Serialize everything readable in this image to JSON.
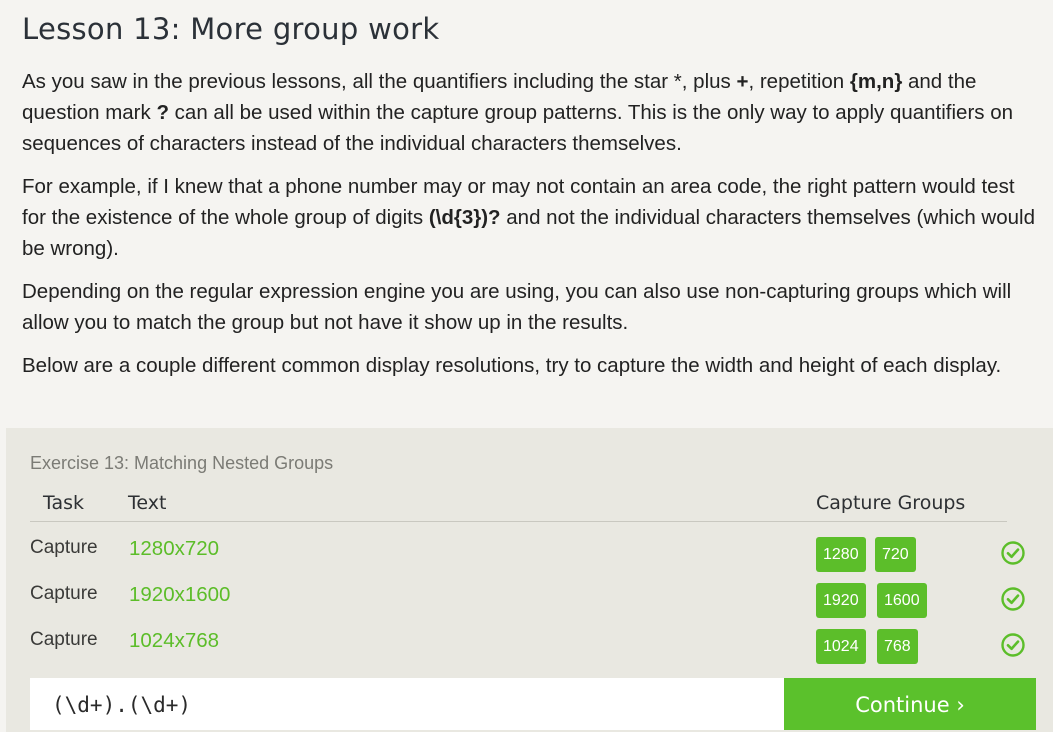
{
  "lesson": {
    "title": "Lesson 13: More group work",
    "p1": {
      "t1": "As you saw in the previous lessons, all the quantifiers including the star ",
      "star": "*",
      "t2": ", plus ",
      "plus": "+",
      "t3": ", repetition ",
      "rep": "{m,n}",
      "t4": " and the question mark ",
      "qm": "?",
      "t5": " can all be used within the capture group patterns. This is the only way to apply quantifiers on sequences of characters instead of the individual characters themselves."
    },
    "p2": {
      "t1": "For example, if I knew that a phone number may or may not contain an area code, the right pattern would test for the existence of the whole group of digits ",
      "code": "(\\d{3})?",
      "t2": " and not the individual characters themselves (which would be wrong)."
    },
    "p3": "Depending on the regular expression engine you are using, you can also use non-capturing groups which will allow you to match the group but not have it show up in the results.",
    "p4": "Below are a couple different common display resolutions, try to capture the width and height of each display."
  },
  "exercise": {
    "title": "Exercise 13: Matching Nested Groups",
    "headers": {
      "task": "Task",
      "text": "Text",
      "groups": "Capture Groups"
    },
    "rows": [
      {
        "task": "Capture",
        "text": "1280x720",
        "groups": [
          "1280",
          "720"
        ],
        "status": "check-icon"
      },
      {
        "task": "Capture",
        "text": "1920x1600",
        "groups": [
          "1920",
          "1600"
        ],
        "status": "check-icon"
      },
      {
        "task": "Capture",
        "text": "1024x768",
        "groups": [
          "1024",
          "768"
        ],
        "status": "check-icon"
      }
    ],
    "input": {
      "value": "(\\d+).(\\d+)"
    },
    "continue_label": "Continue ›"
  },
  "colors": {
    "accent_green": "#5cbe2a",
    "page_bg": "#f5f4f1",
    "panel_bg": "#e9e8e1"
  }
}
